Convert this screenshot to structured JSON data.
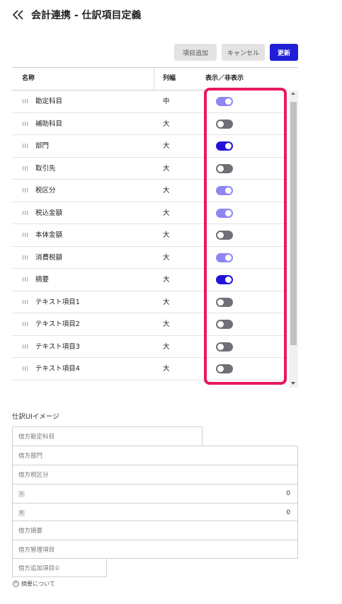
{
  "header": {
    "title": "会計連携 - 仕訳項目定義",
    "back_icon": "double-chevron-left-icon"
  },
  "toolbar": {
    "add_label": "項目追加",
    "cancel_label": "キャンセル",
    "update_label": "更新",
    "primary_color": "#1f1fd6"
  },
  "table": {
    "columns": [
      "名称",
      "列幅",
      "表示／非表示"
    ],
    "rows": [
      {
        "name": "勘定科目",
        "width": "中",
        "toggle": "on-light"
      },
      {
        "name": "補助科目",
        "width": "大",
        "toggle": "off"
      },
      {
        "name": "部門",
        "width": "大",
        "toggle": "on-dark"
      },
      {
        "name": "取引先",
        "width": "大",
        "toggle": "off"
      },
      {
        "name": "税区分",
        "width": "大",
        "toggle": "on-light"
      },
      {
        "name": "税込金額",
        "width": "大",
        "toggle": "on-light"
      },
      {
        "name": "本体金額",
        "width": "大",
        "toggle": "off"
      },
      {
        "name": "消費税額",
        "width": "大",
        "toggle": "on-light"
      },
      {
        "name": "摘要",
        "width": "大",
        "toggle": "on-dark"
      },
      {
        "name": "テキスト項目1",
        "width": "大",
        "toggle": "off"
      },
      {
        "name": "テキスト項目2",
        "width": "大",
        "toggle": "off"
      },
      {
        "name": "テキスト項目3",
        "width": "大",
        "toggle": "off"
      },
      {
        "name": "テキスト項目4",
        "width": "大",
        "toggle": "off"
      }
    ],
    "highlight_color": "#e8195a"
  },
  "preview": {
    "title": "仕訳UIイメージ",
    "fields": {
      "debit_account": "借方勘定科目",
      "debit_department": "借方部門",
      "debit_tax_category": "借方税区分",
      "tax_incl_icon": "込",
      "tax_incl_value": "0",
      "tax_icon": "税",
      "tax_value": "0",
      "debit_memo": "借方摘要",
      "debit_management": "借方管理項目",
      "debit_extra": "借方追加項目①"
    },
    "footnote": "摘要について",
    "footnote_icon": "①"
  }
}
